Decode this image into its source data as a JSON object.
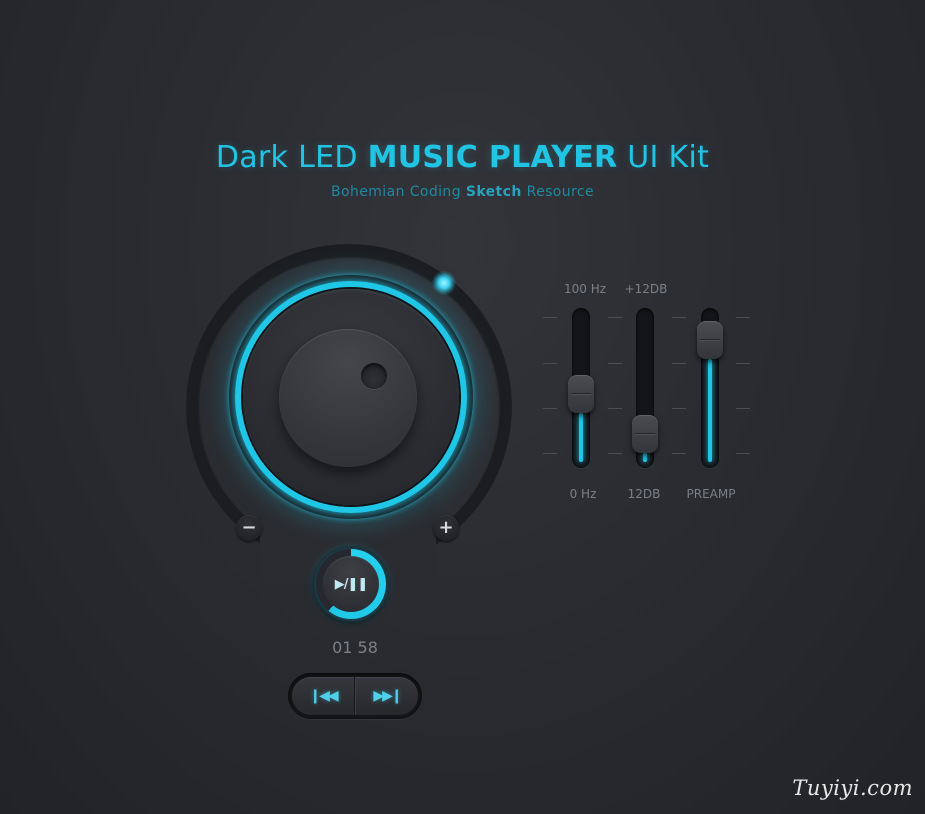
{
  "header": {
    "title_regular_1": "Dark LED ",
    "title_bold": "MUSIC PLAYER",
    "title_regular_2": " UI Kit",
    "subtitle_1": "Bohemian Coding ",
    "subtitle_bold": "Sketch",
    "subtitle_2": " Resource"
  },
  "knob": {
    "minus_label": "−",
    "plus_label": "+",
    "led_color": "#1fc6e6"
  },
  "player": {
    "play_pause_icon": "play-pause-icon",
    "play_pause_label": "▶/❚❚",
    "progress": 0.61,
    "time": "01 58"
  },
  "transport": {
    "previous_label": "❙◀◀",
    "next_label": "▶▶❙"
  },
  "equalizer": {
    "sliders": [
      {
        "top_label": "100 Hz",
        "bottom_label": "0 Hz",
        "level": 0.42
      },
      {
        "top_label": "+12DB",
        "bottom_label": "12DB",
        "level": 0.05
      },
      {
        "top_label": "",
        "bottom_label": "PREAMP",
        "level": 0.93
      }
    ]
  },
  "watermark": "Tuyiyi.com",
  "colors": {
    "accent": "#22c4e3",
    "background": "#2a2c31"
  }
}
